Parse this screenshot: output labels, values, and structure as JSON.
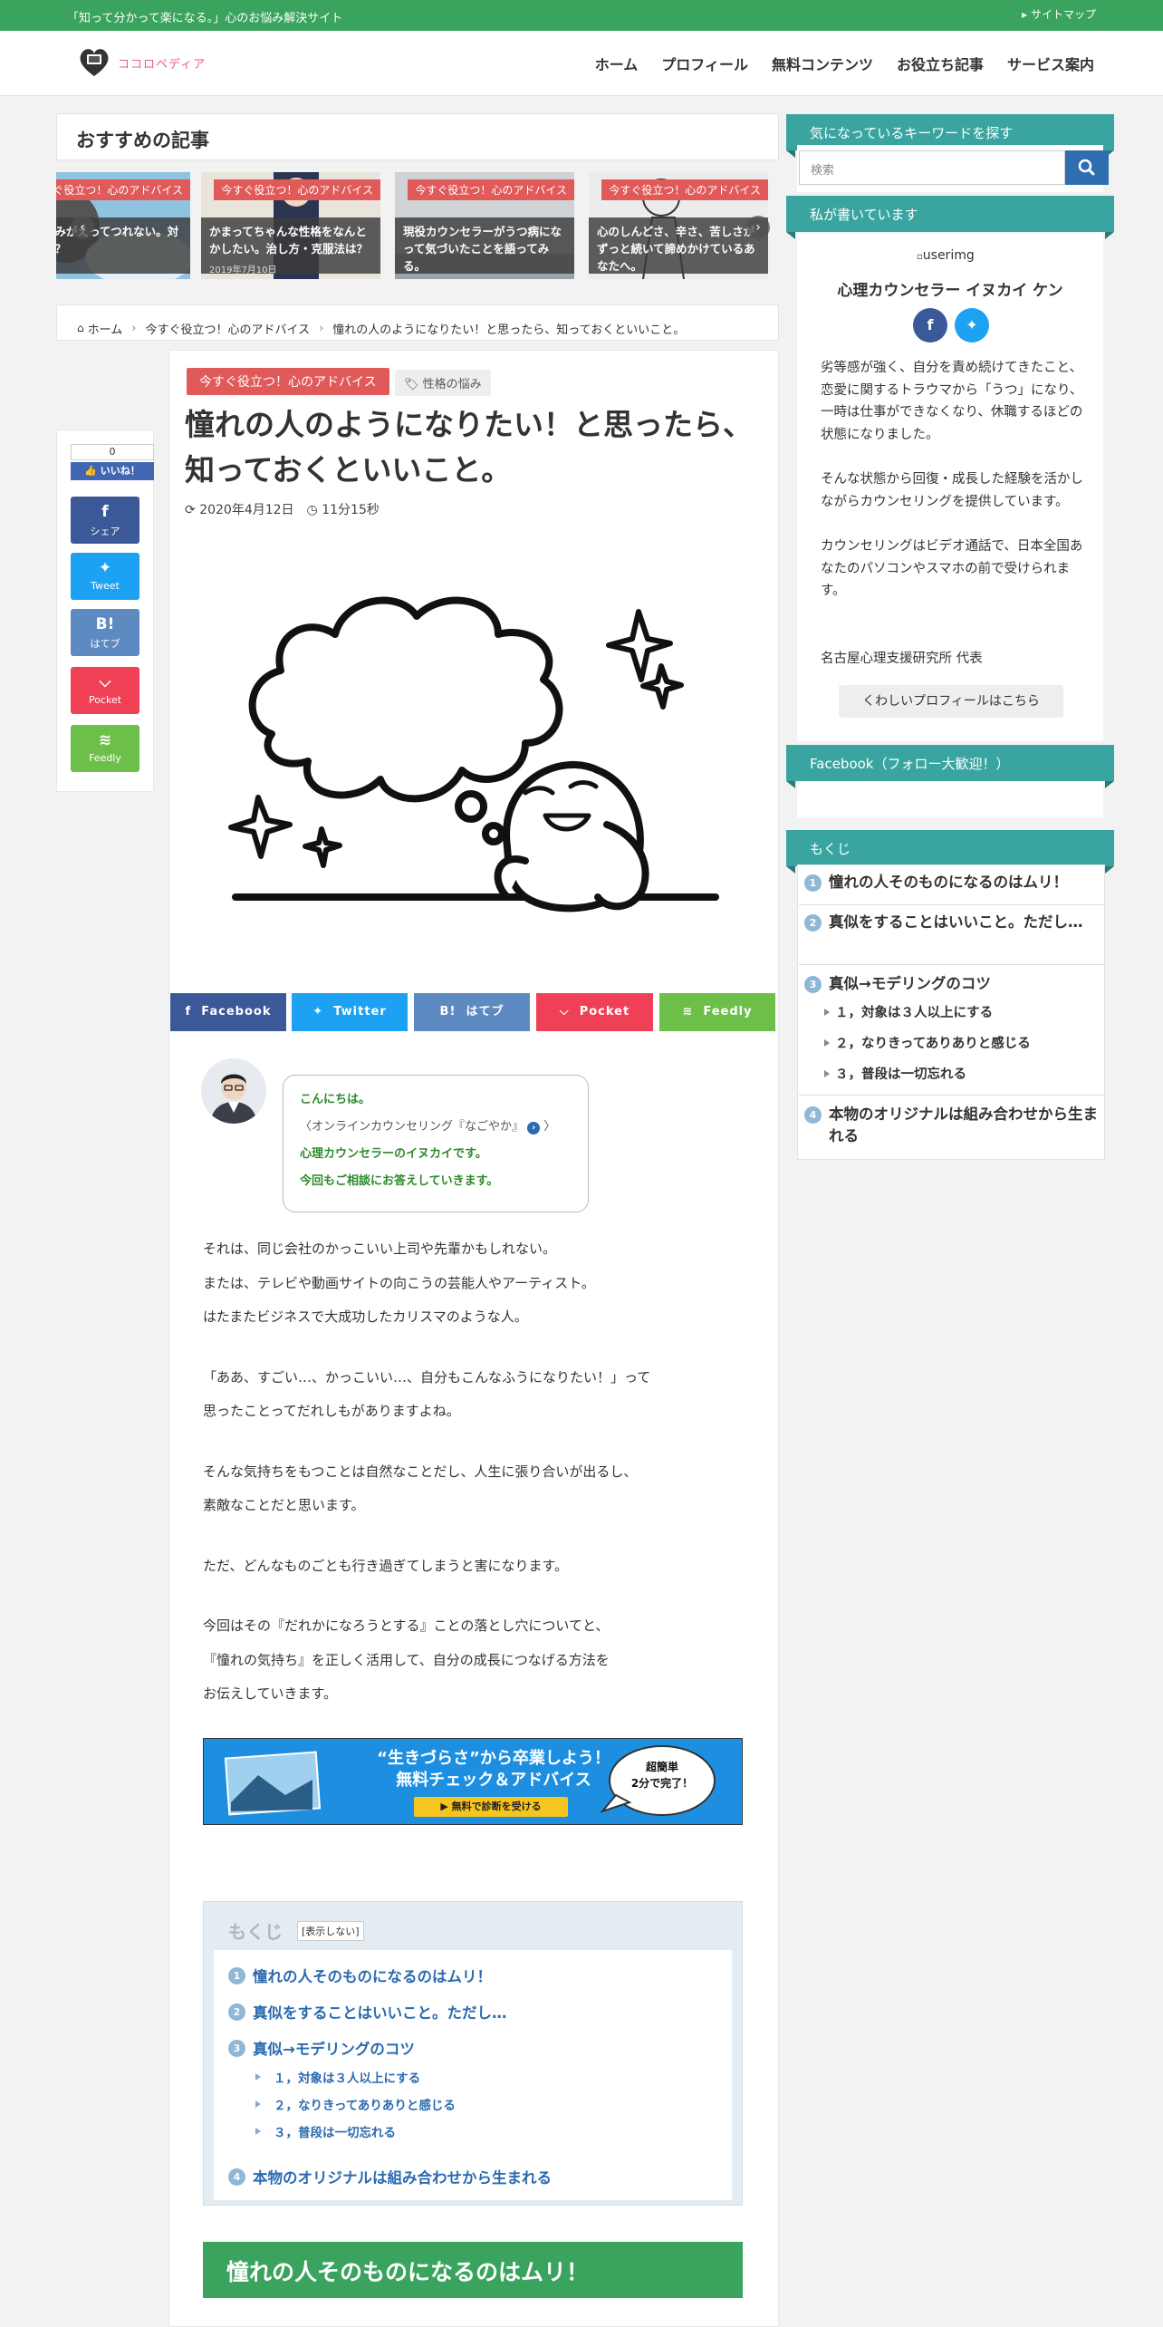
{
  "topbar": {
    "tagline": "「知って分かって楽になる。」心のお悩み解決サイト",
    "sitemap": "サイトマップ"
  },
  "header": {
    "logo_text": "ココロペディア",
    "nav": [
      "ホーム",
      "プロフィール",
      "無料コンテンツ",
      "お役立ち記事",
      "サービス案内"
    ]
  },
  "recommended": {
    "title": "おすすめの記事",
    "slides": [
      {
        "category": "今すぐ役立つ！心のアドバイス",
        "caption": "妹…しみがえってつれない。対処法は？",
        "date": ""
      },
      {
        "category": "今すぐ役立つ！心のアドバイス",
        "caption": "かまってちゃんな性格をなんとかしたい。治し方・克服法は？",
        "date": "2019年7月10日"
      },
      {
        "category": "今すぐ役立つ！心のアドバイス",
        "caption": "現役カウンセラーがうつ病になって気づいたことを語ってみる。",
        "date": ""
      },
      {
        "category": "今すぐ役立つ！心のアドバイス",
        "caption": "心のしんどさ、辛さ、苦しさがずっと続いて諦めかけているあなたへ。",
        "date": ""
      }
    ]
  },
  "breadcrumb": {
    "home": "ホーム",
    "category": "今すぐ役立つ！心のアドバイス",
    "current": "憧れの人のようになりたい！と思ったら、知っておくといいこと。"
  },
  "share_side": {
    "like_count": "0",
    "like_label": "いいね！",
    "buttons": [
      {
        "icon": "f",
        "label": "シェア",
        "color": "#3b5998"
      },
      {
        "icon": "🐦",
        "label": "Tweet",
        "color": "#1da1f2"
      },
      {
        "icon": "B!",
        "label": "はてブ",
        "color": "#5d8ac1"
      },
      {
        "icon": "⛉",
        "label": "Pocket",
        "color": "#ef4056"
      },
      {
        "icon": "◉",
        "label": "Feedly",
        "color": "#6cc04a"
      }
    ]
  },
  "article": {
    "category": "今すぐ役立つ！心のアドバイス",
    "tag": "性格の悩み",
    "title": "憧れの人のようになりたい！と思ったら、知っておくといいこと。",
    "date": "2020年4月12日",
    "read_time": "11分15秒",
    "share_bar": [
      {
        "icon": "f",
        "label": "Facebook",
        "color": "#3b5998"
      },
      {
        "icon": "🐦",
        "label": "Twitter",
        "color": "#1da1f2"
      },
      {
        "icon": "B!",
        "label": "はてブ",
        "color": "#5d8ac1"
      },
      {
        "icon": "⛉",
        "label": "Pocket",
        "color": "#ef4056"
      },
      {
        "icon": "◉",
        "label": "Feedly",
        "color": "#6cc04a"
      }
    ],
    "greeting": {
      "line1": "こんにちは。",
      "line2": "〈オンラインカウンセリング『なごやか』",
      "line2_end": "〉",
      "line3": "心理カウンセラーのイヌカイです。",
      "line4": "今回もご相談にお答えしていきます。"
    },
    "paragraphs": [
      [
        "それは、同じ会社のかっこいい上司や先輩かもしれない。",
        "または、テレビや動画サイトの向こうの芸能人やアーティスト。",
        "はたまたビジネスで大成功したカリスマのような人。"
      ],
      [
        "「ああ、すごい…、かっこいい…、自分もこんなふうになりたい！」って",
        "思ったことってだれしもがありますよね。"
      ],
      [
        "そんな気持ちをもつことは自然なことだし、人生に張り合いが出るし、",
        "素敵なことだと思います。"
      ],
      [
        "ただ、どんなものごとも行き過ぎてしまうと害になります。"
      ],
      [
        "今回はその『だれかになろうとする』ことの落とし穴についてと、",
        "『憧れの気持ち』を正しく活用して、自分の成長につなげる方法を",
        "お伝えしていきます。"
      ]
    ],
    "banner": {
      "line1": "“生きづらさ”から卒業しよう！",
      "line2": "無料チェック＆アドバイス",
      "button": "▶ 無料で診断を受ける",
      "bubble1": "超簡単",
      "bubble2": "2分で完了！"
    },
    "toc": {
      "title": "もくじ",
      "toggle": "[表示しない]",
      "items": [
        {
          "num": "1",
          "label": "憧れの人そのものになるのはムリ！"
        },
        {
          "num": "2",
          "label": "真似をすることはいいこと。ただし…"
        },
        {
          "num": "3",
          "label": "真似→モデリングのコツ"
        },
        {
          "num": "4",
          "label": "本物のオリジナルは組み合わせから生まれる"
        }
      ],
      "subitems": [
        "１，対象は３人以上にする",
        "２，なりきってありありと感じる",
        "３，普段は一切忘れる"
      ]
    },
    "h2": "憧れの人そのものになるのはムリ！"
  },
  "sidebar": {
    "search_head": "気になっているキーワードを探す",
    "search_placeholder": "検索",
    "profile_head": "私が書いています",
    "profile_img_alt": "userimg",
    "profile_name": "心理カウンセラー イヌカイ ケン",
    "profile_text": [
      "劣等感が強く、自分を責め続けてきたこと、恋愛に関するトラウマから「うつ」になり、一時は仕事ができなくなり、休職するほどの状態になりました。",
      "そんな状態から回復・成長した経験を活かしながらカウンセリングを提供しています。",
      "カウンセリングはビデオ通話で、日本全国あなたのパソコンやスマホの前で受けられます。",
      "名古屋心理支援研究所 代表"
    ],
    "profile_button": "くわしいプロフィールはこちら",
    "facebook_head": "Facebook（フォロー大歓迎！）",
    "toc_head": "もくじ",
    "toc_items": [
      {
        "num": "1",
        "label": "憧れの人そのものになるのはムリ！"
      },
      {
        "num": "2",
        "label": "真似をすることはいいこと。ただし…"
      },
      {
        "num": "3",
        "label": "真似→モデリングのコツ"
      },
      {
        "num": "4",
        "label": "本物のオリジナルは組み合わせから生まれる"
      }
    ],
    "toc_sub": [
      "１，対象は３人以上にする",
      "２，なりきってありありと感じる",
      "３，普段は一切忘れる"
    ]
  }
}
